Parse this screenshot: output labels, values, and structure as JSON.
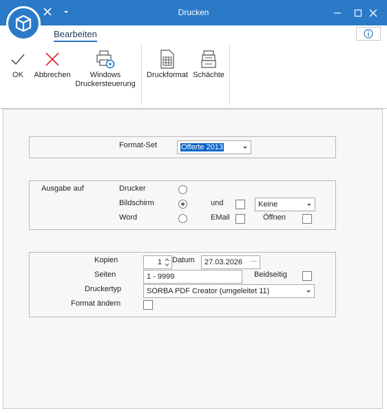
{
  "window": {
    "title": "Drucken"
  },
  "ribbon": {
    "tab": "Bearbeiten",
    "buttons": {
      "ok": "OK",
      "abbrechen": "Abbrechen",
      "windows_line1": "Windows",
      "windows_line2": "Druckersteuerung",
      "druckformat": "Druckformat",
      "schaechte": "Schächte"
    }
  },
  "format_set": {
    "label": "Format-Set",
    "value": "Offerte 2013"
  },
  "ausgabe": {
    "label": "Ausgabe auf",
    "options": {
      "drucker": "Drucker",
      "bildschirm": "Bildschirm",
      "word": "Word"
    },
    "selected": "Bildschirm",
    "und_label": "und",
    "email_label": "EMail",
    "oeffnen_label": "Öffnen",
    "und_value": "Keine"
  },
  "druck": {
    "kopien_label": "Kopien",
    "kopien_value": "1",
    "datum_label": "Datum",
    "datum_value": "27.03.2026",
    "datum_button": "···",
    "seiten_label": "Seiten",
    "seiten_value": "1 - 9999",
    "beidseitig_label": "Beidseitig",
    "druckertyp_label": "Druckertyp",
    "druckertyp_value": "SORBA PDF Creator (umgeleitet 11)",
    "format_aendern_label": "Format ändern"
  },
  "colors": {
    "accent": "#2a7ac8",
    "selection": "#0a64c8",
    "cancel_red": "#e0242a"
  }
}
